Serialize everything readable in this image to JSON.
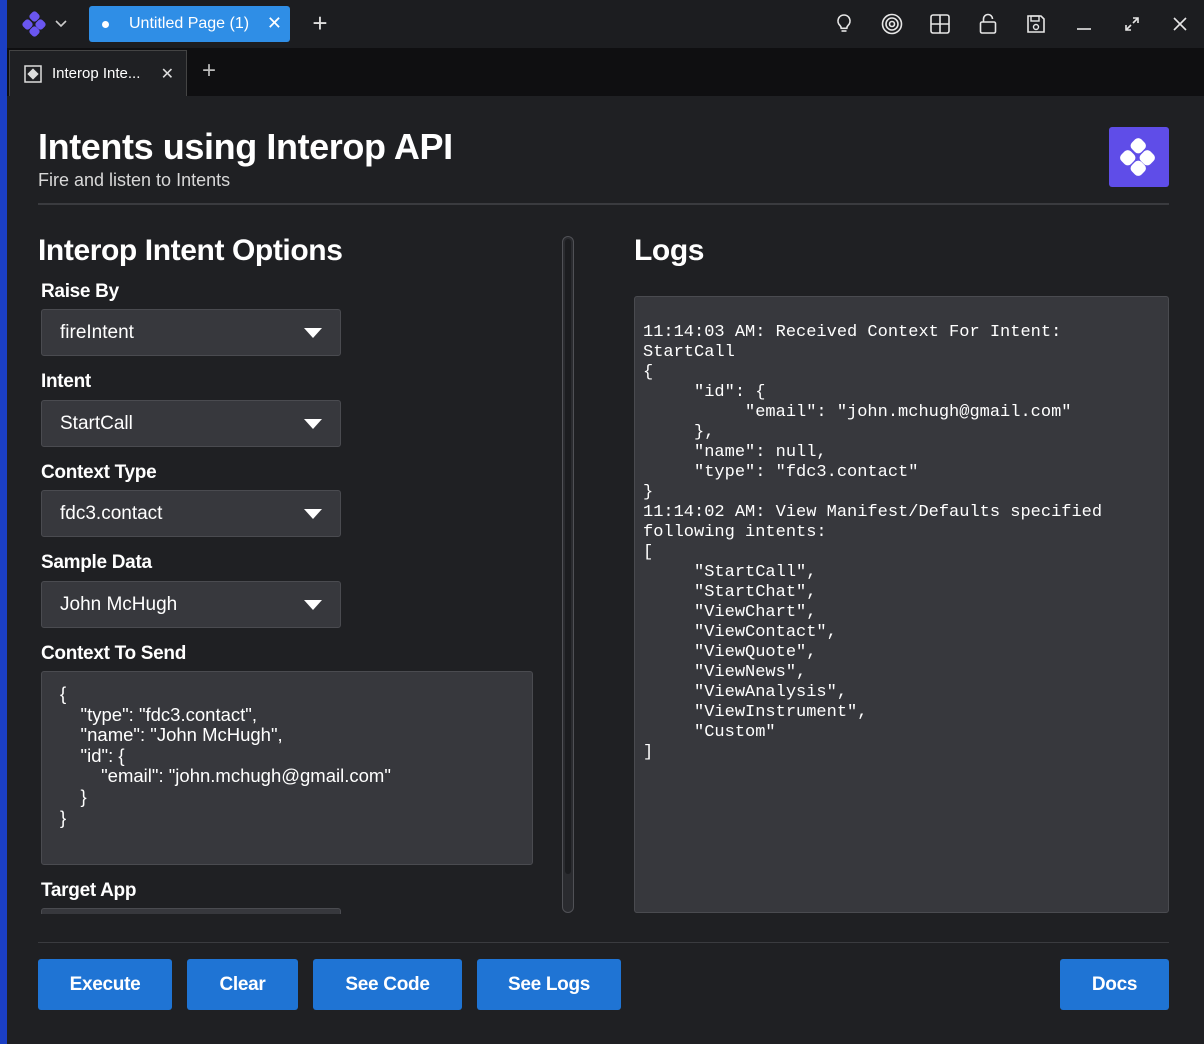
{
  "titlebar": {
    "page_tab_title": "Untitled Page (1)",
    "page_tab_close": "✕",
    "add_page": "+"
  },
  "tabstrip": {
    "view_tab_title": "Interop Inte...",
    "view_tab_close": "✕",
    "add_view": "+"
  },
  "header": {
    "title": "Intents using Interop API",
    "subtitle": "Fire and listen to Intents"
  },
  "options": {
    "heading": "Interop Intent Options",
    "raise_by": {
      "label": "Raise By",
      "value": "fireIntent"
    },
    "intent": {
      "label": "Intent",
      "value": "StartCall"
    },
    "context_type": {
      "label": "Context Type",
      "value": "fdc3.contact"
    },
    "sample_data": {
      "label": "Sample Data",
      "value": "John McHugh"
    },
    "context_to_send": {
      "label": "Context To Send",
      "value": "{\n    \"type\": \"fdc3.contact\",\n    \"name\": \"John McHugh\",\n    \"id\": {\n        \"email\": \"john.mchugh@gmail.com\"\n    }\n}"
    },
    "target_app": {
      "label": "Target App"
    }
  },
  "logs": {
    "heading": "Logs",
    "content": "11:14:03 AM: Received Context For Intent:\nStartCall\n{\n     \"id\": {\n          \"email\": \"john.mchugh@gmail.com\"\n     },\n     \"name\": null,\n     \"type\": \"fdc3.contact\"\n}\n11:14:02 AM: View Manifest/Defaults specified\nfollowing intents:\n[\n     \"StartCall\",\n     \"StartChat\",\n     \"ViewChart\",\n     \"ViewContact\",\n     \"ViewQuote\",\n     \"ViewNews\",\n     \"ViewAnalysis\",\n     \"ViewInstrument\",\n     \"Custom\"\n]"
  },
  "buttons": {
    "execute": "Execute",
    "clear": "Clear",
    "see_code": "See Code",
    "see_logs": "See Logs",
    "docs": "Docs"
  },
  "colors": {
    "accent": "#1f74d4",
    "page_tab": "#2f8ee6",
    "brand": "#5f4de8",
    "background": "#1f2023",
    "panel": "#37383d"
  },
  "icons": {
    "app_logo": "openfin-logo-icon",
    "titlebar": [
      "lightbulb-icon",
      "target-icon",
      "grid-icon",
      "lock-icon",
      "save-icon",
      "minimize-icon",
      "maximize-icon",
      "close-icon"
    ]
  }
}
